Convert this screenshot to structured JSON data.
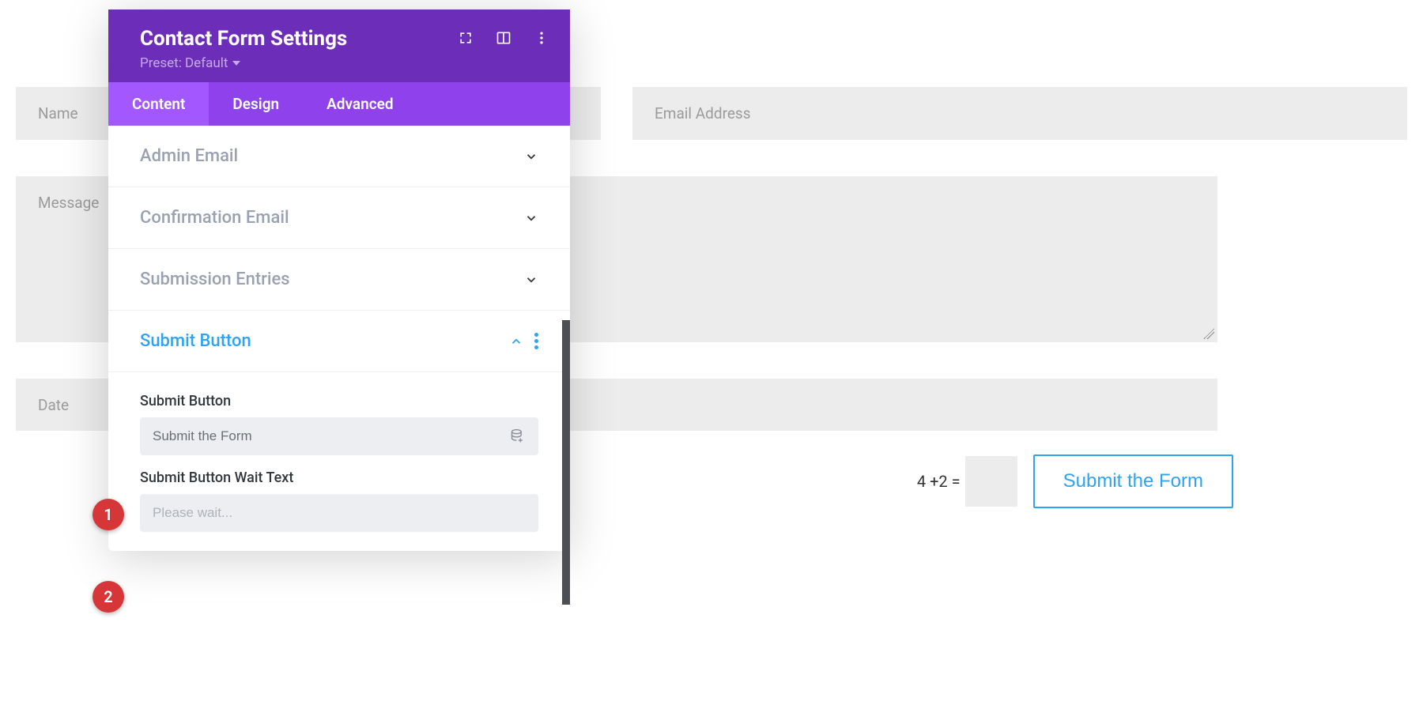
{
  "form": {
    "name_placeholder": "Name",
    "email_placeholder": "Email Address",
    "message_placeholder": "Message",
    "date_placeholder": "Date",
    "captcha_text": "4 +2 =",
    "submit_label": "Submit the Form"
  },
  "panel": {
    "title": "Contact Form Settings",
    "preset_label": "Preset: Default",
    "tabs": {
      "content": "Content",
      "design": "Design",
      "advanced": "Advanced"
    },
    "sections": {
      "admin_email": "Admin Email",
      "confirmation_email": "Confirmation Email",
      "submission_entries": "Submission Entries",
      "submit_button": "Submit Button"
    },
    "fields": {
      "submit_button_label": "Submit Button",
      "submit_button_value": "Submit the Form",
      "wait_text_label": "Submit Button Wait Text",
      "wait_text_placeholder": "Please wait..."
    }
  },
  "annotations": {
    "one": "1",
    "two": "2"
  }
}
